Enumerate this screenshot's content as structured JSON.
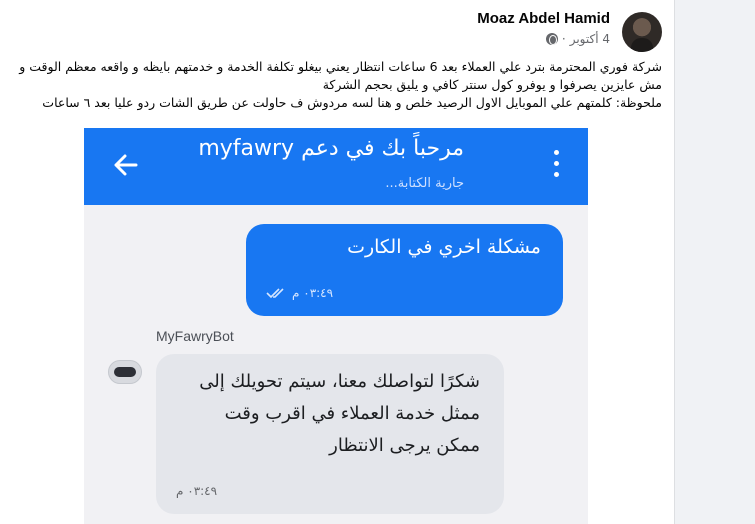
{
  "post": {
    "author": "Moaz Abdel Hamid",
    "date": "4 أكتوبر",
    "privacy_icon": "globe-icon",
    "text_lines": [
      "شركة فوري المحترمة بترد علي العملاء بعد 6 ساعات انتظار يعني بيغلو تكلفة الخدمة و خدمتهم بايظه و واقعه معظم الوقت و مش عايزين يصرفوا و يوفرو كول سنتر كافي و يليق بحجم الشركة",
      "ملحوظة: كلمتهم علي الموبايل الاول الرصيد خلص و هنا لسه مردوش ف حاولت عن طريق الشات ردو عليا بعد ٦ ساعات"
    ]
  },
  "screenshot": {
    "chat_title": "مرحباً بك في دعم myfawry",
    "typing_status": "جارية الكتابة...",
    "back_icon": "arrow-left-icon",
    "menu_icon": "more-vertical-icon",
    "outgoing": {
      "text": "مشكلة اخري في الكارت",
      "time": "٠٣:٤٩ م",
      "status_icon": "double-check-icon"
    },
    "bot_name": "MyFawryBot",
    "incoming": {
      "text": "شكرًا لتواصلك معنا، سيتم تحويلك إلى ممثل خدمة العملاء في اقرب وقت ممكن يرجى الانتظار",
      "time": "٠٣:٤٩ م"
    }
  },
  "colors": {
    "brand": "#1877f2",
    "incoming_bubble": "#e4e6eb",
    "page_bg": "#f0f2f5"
  }
}
